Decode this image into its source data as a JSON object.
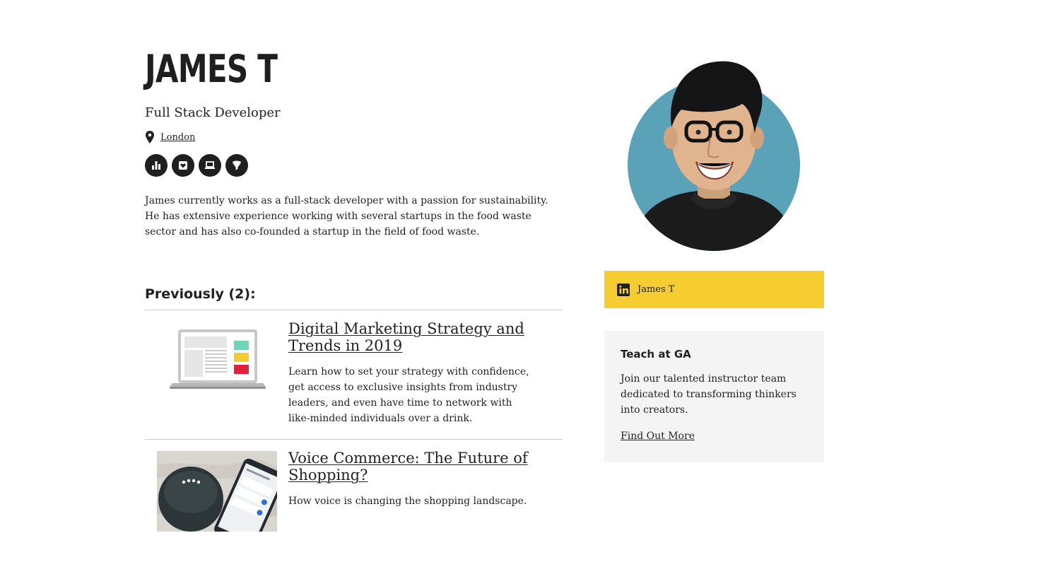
{
  "profile": {
    "name": "JAMES T",
    "title": "Full Stack Developer",
    "location": "London",
    "topics": [
      {
        "icon": "bar-chart-icon"
      },
      {
        "icon": "heart-card-icon"
      },
      {
        "icon": "laptop-icon"
      },
      {
        "icon": "funnel-icon"
      }
    ],
    "bio": "James currently works as a full-stack developer with a passion for sustainability. He has extensive experience working with several startups in the food waste sector and has also co-founded a startup in the field of food waste."
  },
  "previous": {
    "heading": "Previously (2):",
    "courses": [
      {
        "title": "Digital Marketing Strategy and Trends in 2019",
        "description": "Learn how to set your strategy with confidence, get access to exclusive insights from industry leaders, and even have time to network with like-minded individuals over a drink.",
        "thumbnail": "laptop-illustration"
      },
      {
        "title": "Voice Commerce: The Future of Shopping?",
        "description": "How voice is changing the shopping landscape.",
        "thumbnail": "smart-speaker-photo"
      }
    ]
  },
  "sidebar": {
    "linkedin_label": "James T",
    "linkedin_icon": "linkedin-icon",
    "teach": {
      "heading": "Teach at GA",
      "text": "Join our talented instructor team dedicated to transforming thinkers into creators.",
      "link": "Find Out More"
    }
  },
  "colors": {
    "accent_yellow": "#f5cd31",
    "avatar_bg": "#5aa2b8",
    "text": "#222222",
    "panel_bg": "#f4f4f4"
  }
}
